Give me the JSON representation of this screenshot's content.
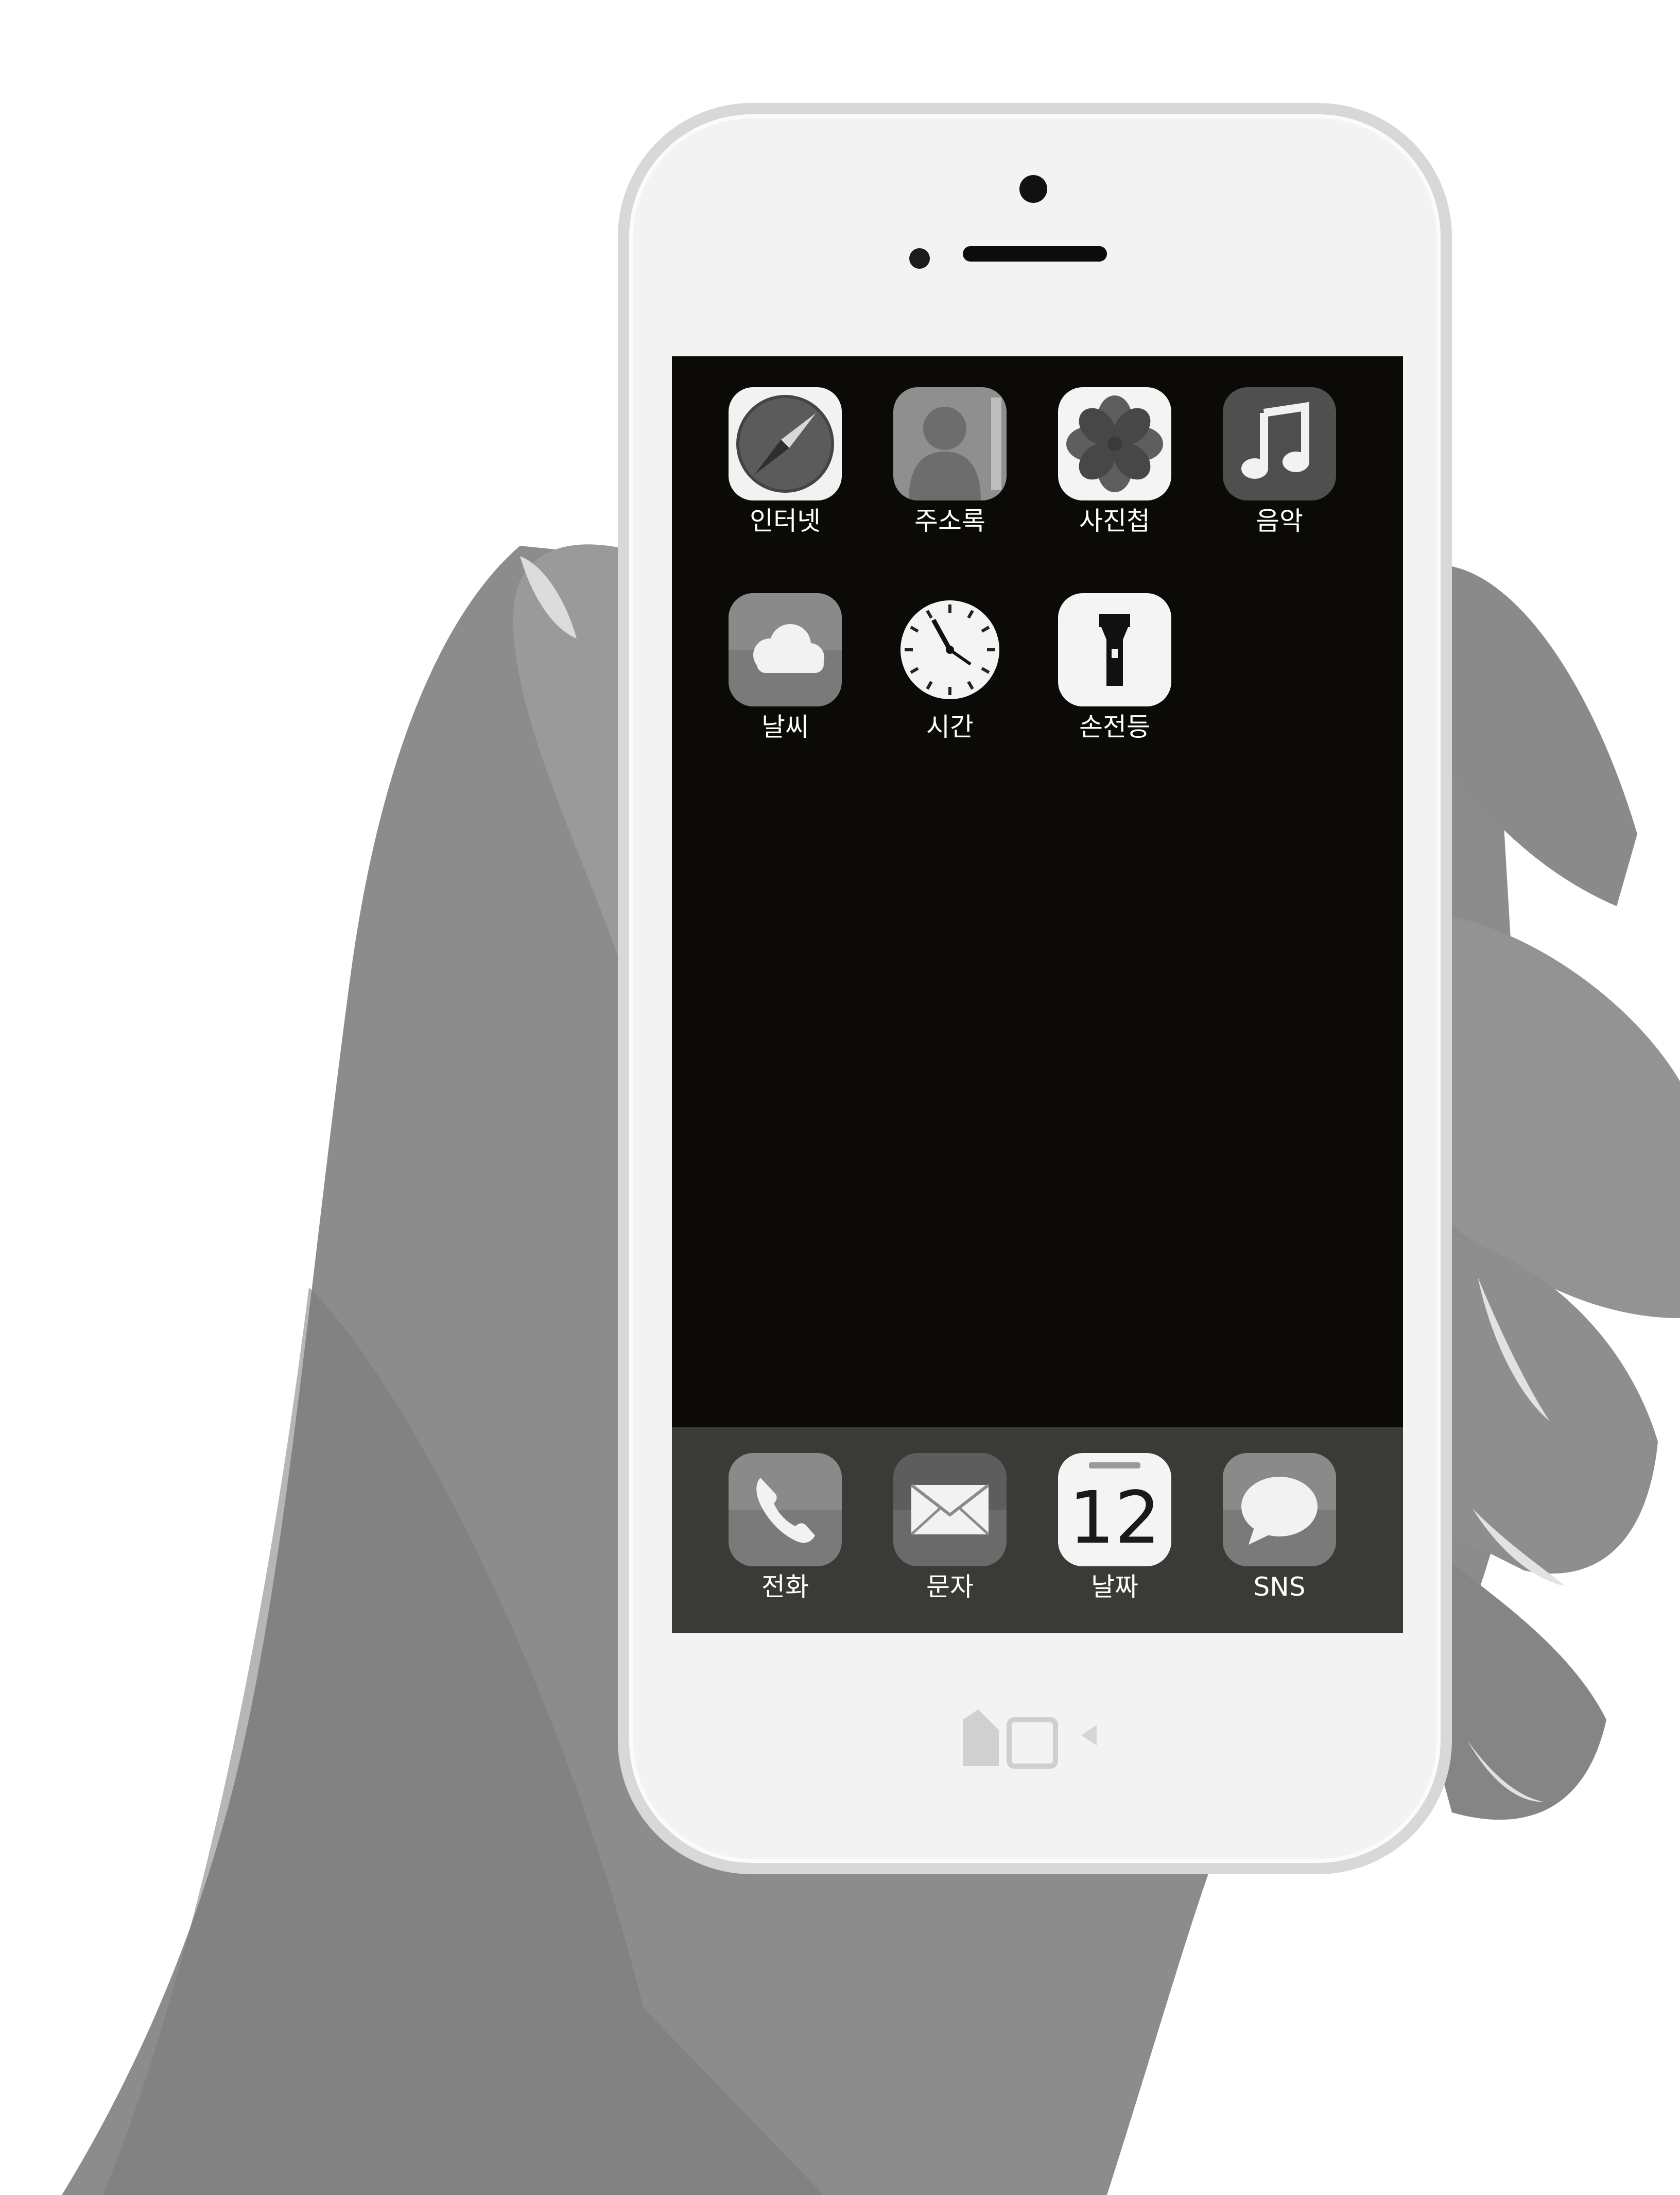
{
  "home_screen": {
    "apps": [
      {
        "label": "인터넷",
        "icon": "compass-icon"
      },
      {
        "label": "주소록",
        "icon": "contact-silhouette-icon"
      },
      {
        "label": "사진첩",
        "icon": "flower-icon"
      },
      {
        "label": "음악",
        "icon": "music-note-icon"
      },
      {
        "label": "날씨",
        "icon": "cloud-icon"
      },
      {
        "label": "시간",
        "icon": "clock-icon"
      },
      {
        "label": "손전등",
        "icon": "flashlight-icon"
      }
    ]
  },
  "dock": {
    "apps": [
      {
        "label": "전화",
        "icon": "phone-handset-icon"
      },
      {
        "label": "문자",
        "icon": "envelope-icon"
      },
      {
        "label": "날짜",
        "icon": "calendar-icon",
        "day_number": "12"
      },
      {
        "label": "SNS",
        "icon": "chat-bubble-icon"
      }
    ]
  },
  "colors": {
    "screen_background": "#0b0a07",
    "dock_background": "#3a3a37",
    "label_text": "#ffffff",
    "skin_tone": "#8e8e8e"
  }
}
